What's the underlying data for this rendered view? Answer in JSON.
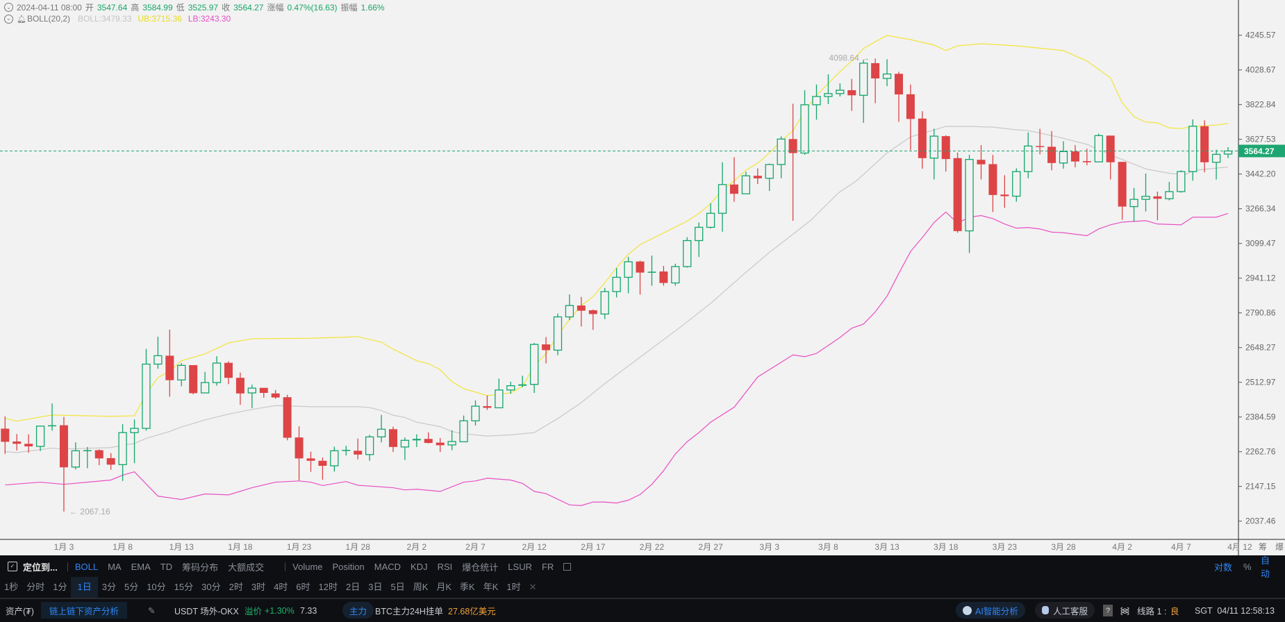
{
  "header": {
    "datetime": "2024-04-11 08:00",
    "open_label": "开",
    "open": "3547.64",
    "high_label": "高",
    "high": "3584.99",
    "low_label": "低",
    "low": "3525.97",
    "close_label": "收",
    "close": "3564.27",
    "change_label": "涨幅",
    "change": "0.47%(16.63)",
    "amp_label": "振幅",
    "amp": "1.66%",
    "indicator": "BOLL(20,2)",
    "boll": "BOLL:3479.33",
    "ub": "UB:3715.36",
    "lb": "LB:3243.30"
  },
  "colors": {
    "up": "#13a56a",
    "down": "#dd4446",
    "mid": "#c8c8c8",
    "upper": "#f2e43a",
    "lower": "#e94fc4",
    "price": "#1ea672"
  },
  "chart_data": {
    "type": "candlestick",
    "scale": "log",
    "ylim": [
      2037.46,
      4245.57
    ],
    "y_ticks": [
      "4245.57",
      "4028.67",
      "3822.84",
      "3627.53",
      "3442.20",
      "3266.34",
      "3099.47",
      "2941.12",
      "2790.86",
      "2648.27",
      "2512.97",
      "2384.59",
      "2262.76",
      "2147.15",
      "2037.46"
    ],
    "x_labels": [
      {
        "text": "1月 3",
        "i": 5
      },
      {
        "text": "1月 8",
        "i": 10
      },
      {
        "text": "1月 13",
        "i": 15
      },
      {
        "text": "1月 18",
        "i": 20
      },
      {
        "text": "1月 23",
        "i": 25
      },
      {
        "text": "1月 28",
        "i": 30
      },
      {
        "text": "2月 2",
        "i": 35
      },
      {
        "text": "2月 7",
        "i": 40
      },
      {
        "text": "2月 12",
        "i": 45
      },
      {
        "text": "2月 17",
        "i": 50
      },
      {
        "text": "2月 22",
        "i": 55
      },
      {
        "text": "2月 27",
        "i": 60
      },
      {
        "text": "3月 3",
        "i": 65
      },
      {
        "text": "3月 8",
        "i": 70
      },
      {
        "text": "3月 13",
        "i": 75
      },
      {
        "text": "3月 18",
        "i": 80
      },
      {
        "text": "3月 23",
        "i": 85
      },
      {
        "text": "3月 28",
        "i": 90
      },
      {
        "text": "4月 2",
        "i": 95
      },
      {
        "text": "4月 7",
        "i": 100
      },
      {
        "text": "4月 12",
        "i": 105
      }
    ],
    "ohlc": [
      [
        2343,
        2387,
        2255,
        2297
      ],
      [
        2298,
        2324,
        2267,
        2290
      ],
      [
        2290,
        2323,
        2259,
        2281
      ],
      [
        2281,
        2352,
        2265,
        2352
      ],
      [
        2352,
        2434,
        2336,
        2355
      ],
      [
        2355,
        2385,
        2067.16,
        2210
      ],
      [
        2211,
        2295,
        2203,
        2266
      ],
      [
        2266,
        2279,
        2207,
        2268
      ],
      [
        2268,
        2271,
        2217,
        2240
      ],
      [
        2241,
        2258,
        2202,
        2219
      ],
      [
        2219,
        2359,
        2165,
        2329
      ],
      [
        2329,
        2376,
        2224,
        2344
      ],
      [
        2344,
        2643,
        2336,
        2583
      ],
      [
        2583,
        2692,
        2565,
        2616
      ],
      [
        2616,
        2721,
        2459,
        2521
      ],
      [
        2522,
        2587,
        2498,
        2578
      ],
      [
        2579,
        2579,
        2468,
        2472
      ],
      [
        2473,
        2553,
        2473,
        2512
      ],
      [
        2512,
        2614,
        2500,
        2587
      ],
      [
        2588,
        2594,
        2506,
        2530
      ],
      [
        2530,
        2550,
        2429,
        2471
      ],
      [
        2473,
        2504,
        2417,
        2491
      ],
      [
        2492,
        2492,
        2455,
        2473
      ],
      [
        2471,
        2484,
        2451,
        2456
      ],
      [
        2457,
        2466,
        2302,
        2311
      ],
      [
        2312,
        2351,
        2167,
        2240
      ],
      [
        2240,
        2263,
        2195,
        2232
      ],
      [
        2232,
        2243,
        2169,
        2215
      ],
      [
        2215,
        2280,
        2196,
        2266
      ],
      [
        2266,
        2283,
        2250,
        2269
      ],
      [
        2266,
        2308,
        2237,
        2253
      ],
      [
        2253,
        2321,
        2232,
        2314
      ],
      [
        2314,
        2392,
        2295,
        2341
      ],
      [
        2341,
        2350,
        2262,
        2279
      ],
      [
        2279,
        2312,
        2235,
        2302
      ],
      [
        2302,
        2323,
        2279,
        2307
      ],
      [
        2307,
        2330,
        2291,
        2293
      ],
      [
        2294,
        2310,
        2262,
        2285
      ],
      [
        2286,
        2337,
        2268,
        2298
      ],
      [
        2297,
        2390,
        2297,
        2371
      ],
      [
        2371,
        2445,
        2354,
        2424
      ],
      [
        2424,
        2463,
        2410,
        2418
      ],
      [
        2418,
        2527,
        2418,
        2484
      ],
      [
        2484,
        2515,
        2470,
        2500
      ],
      [
        2500,
        2538,
        2494,
        2505
      ],
      [
        2505,
        2667,
        2473,
        2661
      ],
      [
        2661,
        2691,
        2586,
        2638
      ],
      [
        2638,
        2788,
        2618,
        2774
      ],
      [
        2774,
        2870,
        2761,
        2822
      ],
      [
        2822,
        2859,
        2734,
        2800
      ],
      [
        2802,
        2805,
        2720,
        2786
      ],
      [
        2786,
        2898,
        2765,
        2882
      ],
      [
        2882,
        2986,
        2857,
        2945
      ],
      [
        2945,
        3037,
        2875,
        3015
      ],
      [
        3016,
        3020,
        2869,
        2966
      ],
      [
        2966,
        3043,
        2908,
        2970
      ],
      [
        2971,
        2996,
        2908,
        2920
      ],
      [
        2920,
        3006,
        2908,
        2993
      ],
      [
        2993,
        3129,
        2988,
        3113
      ],
      [
        3113,
        3199,
        3037,
        3176
      ],
      [
        3176,
        3294,
        3170,
        3244
      ],
      [
        3244,
        3504,
        3155,
        3388
      ],
      [
        3388,
        3531,
        3301,
        3341
      ],
      [
        3341,
        3454,
        3341,
        3433
      ],
      [
        3433,
        3472,
        3391,
        3420
      ],
      [
        3420,
        3497,
        3355,
        3492
      ],
      [
        3492,
        3644,
        3420,
        3629
      ],
      [
        3629,
        3828,
        3207,
        3553
      ],
      [
        3553,
        3907,
        3544,
        3822
      ],
      [
        3822,
        3941,
        3737,
        3870
      ],
      [
        3870,
        4002,
        3826,
        3887
      ],
      [
        3887,
        3948,
        3870,
        3907
      ],
      [
        3907,
        3974,
        3787,
        3877
      ],
      [
        3877,
        4090,
        3719,
        4070
      ],
      [
        4070,
        4098.64,
        3831,
        3977
      ],
      [
        3977,
        4094,
        3931,
        4004
      ],
      [
        4005,
        4017,
        3725,
        3882
      ],
      [
        3883,
        3941,
        3569,
        3741
      ],
      [
        3743,
        3785,
        3470,
        3526
      ],
      [
        3526,
        3686,
        3414,
        3645
      ],
      [
        3645,
        3650,
        3455,
        3521
      ],
      [
        3526,
        3556,
        3150,
        3158
      ],
      [
        3159,
        3544,
        3055,
        3519
      ],
      [
        3517,
        3596,
        3414,
        3493
      ],
      [
        3494,
        3543,
        3250,
        3335
      ],
      [
        3337,
        3436,
        3271,
        3329
      ],
      [
        3329,
        3472,
        3301,
        3455
      ],
      [
        3455,
        3666,
        3420,
        3591
      ],
      [
        3591,
        3686,
        3546,
        3586
      ],
      [
        3587,
        3673,
        3462,
        3500
      ],
      [
        3500,
        3617,
        3470,
        3561
      ],
      [
        3562,
        3596,
        3477,
        3508
      ],
      [
        3510,
        3577,
        3488,
        3504
      ],
      [
        3506,
        3659,
        3506,
        3648
      ],
      [
        3648,
        3648,
        3414,
        3504
      ],
      [
        3506,
        3506,
        3213,
        3277
      ],
      [
        3277,
        3371,
        3204,
        3313
      ],
      [
        3313,
        3445,
        3253,
        3328
      ],
      [
        3328,
        3352,
        3210,
        3316
      ],
      [
        3316,
        3402,
        3308,
        3352
      ],
      [
        3352,
        3462,
        3347,
        3455
      ],
      [
        3455,
        3738,
        3408,
        3700
      ],
      [
        3700,
        3733,
        3451,
        3504
      ],
      [
        3504,
        3571,
        3414,
        3546
      ],
      [
        3547.64,
        3584.99,
        3525.97,
        3564.27
      ]
    ],
    "boll_upper": [
      [
        0,
        2380
      ],
      [
        1,
        2370
      ],
      [
        4,
        2392
      ],
      [
        9,
        2387
      ],
      [
        11,
        2389
      ],
      [
        12,
        2471
      ],
      [
        13,
        2531
      ],
      [
        14,
        2555
      ],
      [
        15,
        2596
      ],
      [
        17,
        2623
      ],
      [
        19,
        2667
      ],
      [
        21,
        2684
      ],
      [
        26,
        2686
      ],
      [
        30,
        2692
      ],
      [
        32,
        2670
      ],
      [
        33,
        2642
      ],
      [
        35,
        2596
      ],
      [
        36,
        2585
      ],
      [
        37,
        2561
      ],
      [
        38,
        2515
      ],
      [
        39,
        2489
      ],
      [
        41,
        2463
      ],
      [
        43,
        2473
      ],
      [
        44,
        2497
      ],
      [
        45,
        2577
      ],
      [
        46,
        2623
      ],
      [
        47,
        2698
      ],
      [
        48,
        2763
      ],
      [
        49,
        2822
      ],
      [
        50,
        2860
      ],
      [
        51,
        2921
      ],
      [
        52,
        2988
      ],
      [
        53,
        3049
      ],
      [
        54,
        3094
      ],
      [
        56,
        3149
      ],
      [
        58,
        3206
      ],
      [
        59,
        3243
      ],
      [
        60,
        3292
      ],
      [
        61,
        3361
      ],
      [
        62,
        3407
      ],
      [
        63,
        3462
      ],
      [
        64,
        3499
      ],
      [
        65,
        3554
      ],
      [
        66,
        3618
      ],
      [
        67,
        3676
      ],
      [
        68,
        3785
      ],
      [
        69,
        3877
      ],
      [
        70,
        3948
      ],
      [
        71,
        4018
      ],
      [
        72,
        4083
      ],
      [
        73,
        4161
      ],
      [
        74,
        4204
      ],
      [
        75,
        4244
      ],
      [
        77,
        4217
      ],
      [
        79,
        4183
      ],
      [
        80,
        4148
      ],
      [
        81,
        4178
      ],
      [
        83,
        4191
      ],
      [
        86,
        4178
      ],
      [
        90,
        4148
      ],
      [
        92,
        4083
      ],
      [
        94,
        3981
      ],
      [
        95,
        3833
      ],
      [
        96,
        3754
      ],
      [
        97,
        3723
      ],
      [
        98,
        3719
      ],
      [
        99,
        3691
      ],
      [
        100,
        3687
      ],
      [
        101,
        3699
      ],
      [
        103,
        3707
      ],
      [
        104,
        3715.36
      ]
    ],
    "boll_mid": [
      [
        0,
        2263
      ],
      [
        1,
        2260
      ],
      [
        4,
        2275
      ],
      [
        5,
        2272
      ],
      [
        9,
        2277
      ],
      [
        10,
        2285
      ],
      [
        11,
        2291
      ],
      [
        12,
        2309
      ],
      [
        14,
        2333
      ],
      [
        15,
        2349
      ],
      [
        17,
        2374
      ],
      [
        19,
        2395
      ],
      [
        21,
        2412
      ],
      [
        23,
        2426
      ],
      [
        26,
        2422
      ],
      [
        30,
        2422
      ],
      [
        31,
        2419
      ],
      [
        32,
        2408
      ],
      [
        33,
        2391
      ],
      [
        34,
        2383
      ],
      [
        35,
        2366
      ],
      [
        36,
        2358
      ],
      [
        37,
        2350
      ],
      [
        38,
        2333
      ],
      [
        39,
        2325
      ],
      [
        41,
        2317
      ],
      [
        43,
        2321
      ],
      [
        45,
        2329
      ],
      [
        46,
        2354
      ],
      [
        47,
        2379
      ],
      [
        48,
        2408
      ],
      [
        49,
        2437
      ],
      [
        50,
        2472
      ],
      [
        51,
        2508
      ],
      [
        57.6,
        2738
      ],
      [
        60,
        2831
      ],
      [
        63,
        2967
      ],
      [
        65,
        3058
      ],
      [
        67,
        3143
      ],
      [
        68.5,
        3209
      ],
      [
        70.9,
        3347
      ],
      [
        72.4,
        3407
      ],
      [
        75,
        3554
      ],
      [
        77,
        3641
      ],
      [
        80,
        3699
      ],
      [
        82,
        3699
      ],
      [
        84,
        3695
      ],
      [
        86,
        3680
      ],
      [
        87,
        3676
      ],
      [
        89.5,
        3641
      ],
      [
        92,
        3600
      ],
      [
        94.3,
        3536
      ],
      [
        97,
        3469
      ],
      [
        99,
        3446
      ],
      [
        100.3,
        3439
      ],
      [
        101.2,
        3462
      ],
      [
        104,
        3479.33
      ]
    ],
    "boll_lower": [
      [
        0,
        2152
      ],
      [
        3,
        2161
      ],
      [
        5,
        2154
      ],
      [
        9,
        2168
      ],
      [
        10,
        2184
      ],
      [
        11,
        2195
      ],
      [
        13,
        2116
      ],
      [
        15,
        2105
      ],
      [
        17,
        2123
      ],
      [
        19,
        2120
      ],
      [
        21,
        2143
      ],
      [
        23,
        2161
      ],
      [
        25,
        2165
      ],
      [
        26,
        2161
      ],
      [
        27,
        2150
      ],
      [
        29,
        2163
      ],
      [
        30,
        2151
      ],
      [
        33,
        2143
      ],
      [
        34,
        2136
      ],
      [
        35,
        2138
      ],
      [
        37,
        2131
      ],
      [
        39,
        2161
      ],
      [
        40,
        2165
      ],
      [
        41,
        2174
      ],
      [
        43,
        2168
      ],
      [
        44,
        2157
      ],
      [
        45,
        2131
      ],
      [
        46,
        2124
      ],
      [
        48,
        2088
      ],
      [
        49,
        2086
      ],
      [
        50,
        2097
      ],
      [
        51,
        2097
      ],
      [
        52,
        2094
      ],
      [
        53,
        2103
      ],
      [
        54,
        2121
      ],
      [
        55,
        2154
      ],
      [
        56,
        2199
      ],
      [
        57,
        2255
      ],
      [
        58,
        2297
      ],
      [
        59,
        2329
      ],
      [
        60,
        2366
      ],
      [
        62,
        2420
      ],
      [
        63,
        2476
      ],
      [
        64,
        2533
      ],
      [
        66,
        2590
      ],
      [
        67,
        2619
      ],
      [
        68,
        2612
      ],
      [
        69,
        2625
      ],
      [
        71,
        2689
      ],
      [
        72,
        2727
      ],
      [
        73,
        2744
      ],
      [
        74,
        2795
      ],
      [
        75,
        2862
      ],
      [
        76,
        2962
      ],
      [
        77,
        3062
      ],
      [
        78,
        3127
      ],
      [
        79,
        3199
      ],
      [
        80,
        3250
      ],
      [
        81,
        3196
      ],
      [
        82,
        3225
      ],
      [
        83,
        3233
      ],
      [
        84,
        3218
      ],
      [
        85,
        3192
      ],
      [
        86,
        3172
      ],
      [
        87,
        3175
      ],
      [
        88,
        3168
      ],
      [
        89,
        3153
      ],
      [
        90,
        3150
      ],
      [
        92,
        3136
      ],
      [
        93,
        3168
      ],
      [
        94,
        3188
      ],
      [
        95,
        3201
      ],
      [
        97,
        3208
      ],
      [
        98,
        3192
      ],
      [
        100,
        3188
      ],
      [
        101,
        3225
      ],
      [
        103,
        3225
      ],
      [
        104,
        3243.3
      ]
    ],
    "current_price": "3564.27",
    "min_annotation": {
      "text": "← 2067.16",
      "i": 5,
      "price": 2067.16
    },
    "max_annotation": {
      "text": "4098.64 →",
      "i": 74,
      "price": 4098.64
    }
  },
  "axis_extra": {
    "chip": "筹",
    "liq": "爆"
  },
  "toolbar": {
    "locate": "定位到...",
    "indicators_main": [
      "BOLL",
      "MA",
      "EMA",
      "TD",
      "筹码分布",
      "大额成交"
    ],
    "indicators_sub": [
      "Volume",
      "Position",
      "MACD",
      "KDJ",
      "RSI",
      "爆仓统计",
      "LSUR",
      "FR"
    ],
    "scale_log": "对数",
    "scale_pct": "%",
    "scale_auto": "自动"
  },
  "periods": [
    "1秒",
    "分时",
    "1分",
    "1日",
    "3分",
    "5分",
    "10分",
    "15分",
    "30分",
    "2时",
    "3时",
    "4时",
    "6时",
    "12时",
    "2日",
    "3日",
    "5日",
    "周K",
    "月K",
    "季K",
    "年K",
    "1时"
  ],
  "period_close": "✕",
  "status": {
    "assets": "资产(₮)",
    "analysis_btn": "链上链下资产分析",
    "usdt": "USDT 场外-OKX",
    "premium_label": "溢价",
    "premium": "+1.30%",
    "rate": "7.33",
    "main_tag": "主力",
    "orders_label": "BTC主力24H挂单",
    "orders_value": "27.68亿美元",
    "ai": "AI智能分析",
    "support": "人工客服",
    "help": "?",
    "line_label": "线路 1 :",
    "line_quality": "良",
    "clock": "SGT  04/11 12:58:13"
  }
}
